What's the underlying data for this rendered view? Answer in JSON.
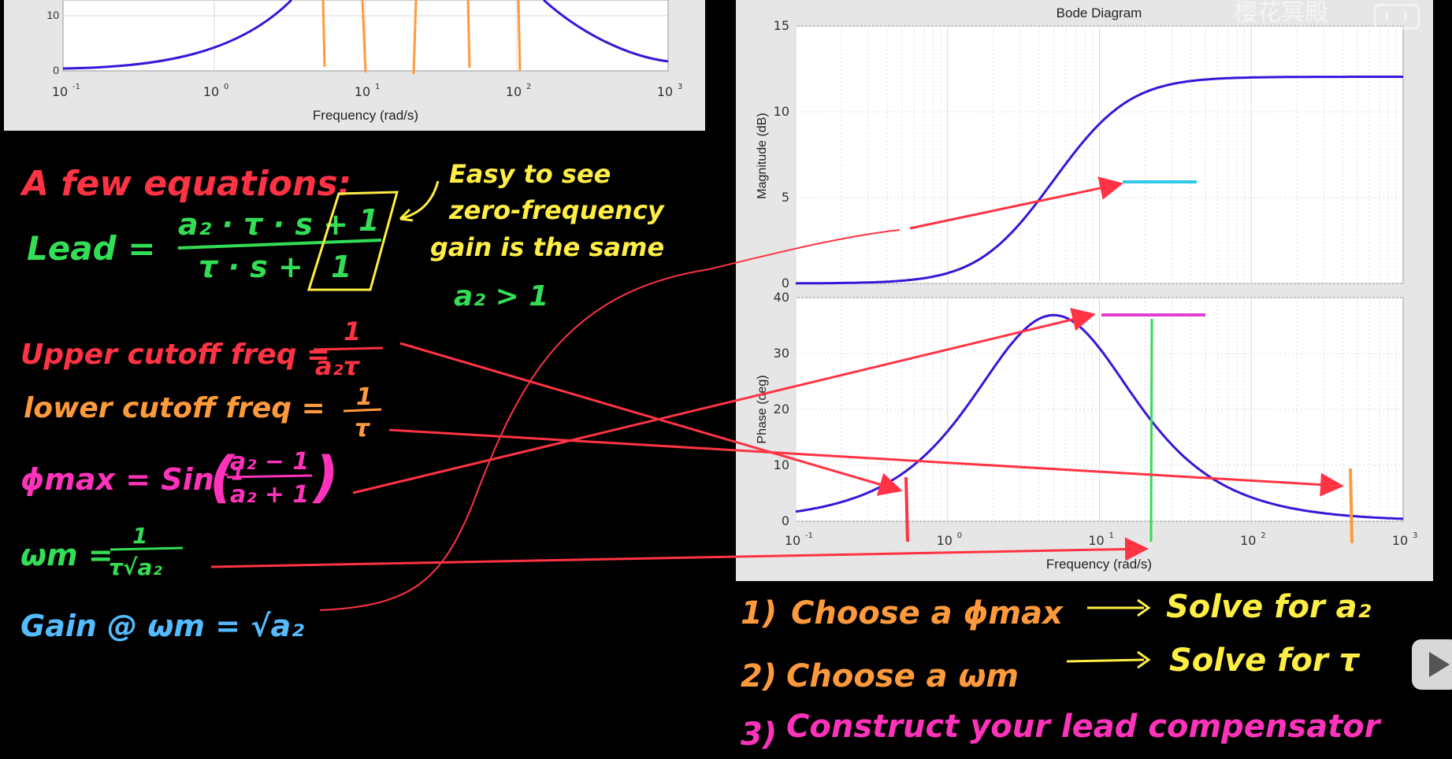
{
  "colors": {
    "red": "#ff3344",
    "orange": "#ff9a3c",
    "yellow": "#ffee44",
    "green": "#33dd55",
    "magenta": "#ff33bb",
    "blue": "#55bbff",
    "curve": "#3a14d9",
    "cyan": "#33c8e8",
    "plot_bg": "#ffffff",
    "panel_bg": "#e6e6e6"
  },
  "watermark": "樱花冥殿",
  "top_plot": {
    "ytick_0": "0",
    "ytick_10": "10",
    "xticks": [
      "10",
      "10",
      "10",
      "10",
      "10"
    ],
    "xexp": [
      "-1",
      "0",
      "1",
      "2",
      "3"
    ],
    "xlabel": "Frequency  (rad/s)"
  },
  "bode": {
    "title": "Bode Diagram",
    "mag_ylabel": "Magnitude (dB)",
    "mag_yticks": [
      "0",
      "5",
      "10",
      "15"
    ],
    "phase_ylabel": "Phase (deg)",
    "phase_yticks": [
      "0",
      "10",
      "20",
      "30",
      "40"
    ],
    "xticks": [
      "10",
      "10",
      "10",
      "10",
      "10"
    ],
    "xexp": [
      "-1",
      "0",
      "1",
      "2",
      "3"
    ],
    "xlabel": "Frequency  (rad/s)"
  },
  "notes": {
    "heading": "A few equations:",
    "lead_label": "Lead =",
    "lead_numerator": "a₂ · τ · s  +",
    "lead_denominator": "τ · s   +",
    "boxed_one": "1",
    "easy": "Easy to see",
    "zero_freq": "zero-frequency",
    "gain_same": "gain is the same",
    "a2_gt_1": "a₂ > 1",
    "upper_label": "Upper cutoff freq =",
    "upper_num": "1",
    "upper_den": "a₂τ",
    "lower_label": "lower cutoff freq =",
    "lower_num": "1",
    "lower_den": "τ",
    "phimax_label": "ϕmax = Sin⁻¹",
    "phimax_num": "a₂ − 1",
    "phimax_den": "a₂ + 1",
    "wm_label": "ωm =",
    "wm_num": "1",
    "wm_den": "τ√a₂",
    "gain_label": "Gain @ ωm = √a₂"
  },
  "steps": [
    {
      "num": "1)",
      "text": "Choose a ϕmax",
      "result": "Solve for a₂"
    },
    {
      "num": "2)",
      "text": "Choose a ωm",
      "result": "Solve for τ"
    },
    {
      "num": "3)",
      "text": "Construct your lead compensator",
      "result": ""
    }
  ]
}
